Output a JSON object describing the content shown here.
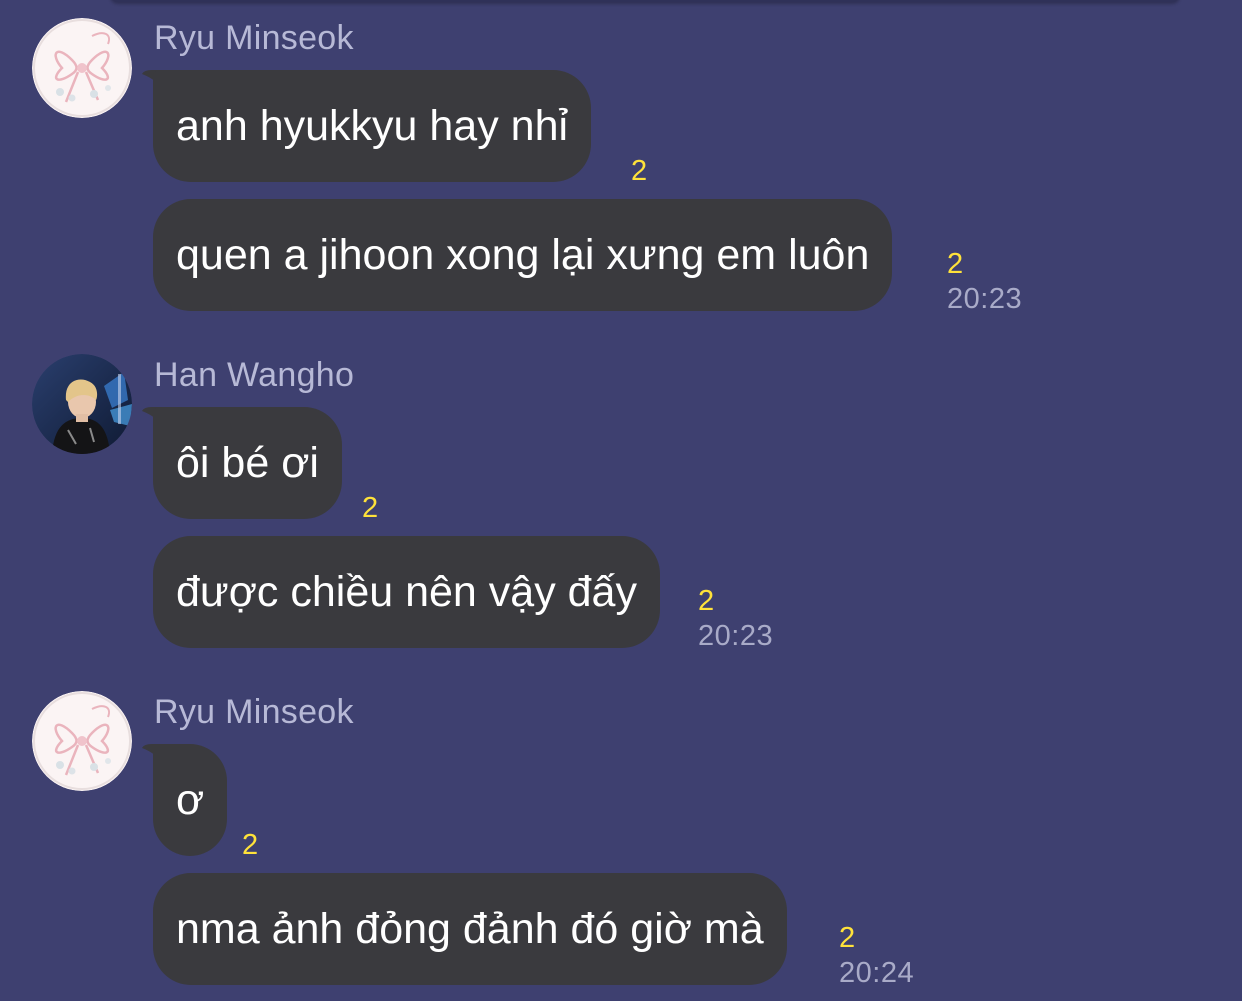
{
  "groups": [
    {
      "sender": "Ryu Minseok",
      "avatar_icon": "ribbon-avatar-icon",
      "messages": [
        {
          "text": "anh hyukkyu hay nhỉ",
          "unread": "2",
          "time": ""
        },
        {
          "text": "quen a jihoon xong lại xưng em luôn",
          "unread": "2",
          "time": "20:23"
        }
      ]
    },
    {
      "sender": "Han Wangho",
      "avatar_icon": "person-photo-avatar-icon",
      "messages": [
        {
          "text": "ôi bé ơi",
          "unread": "2",
          "time": ""
        },
        {
          "text": "được chiều nên vậy đấy",
          "unread": "2",
          "time": "20:23"
        }
      ]
    },
    {
      "sender": "Ryu Minseok",
      "avatar_icon": "ribbon-avatar-icon",
      "messages": [
        {
          "text": "ơ",
          "unread": "2",
          "time": ""
        },
        {
          "text": "nma ảnh đỏng đảnh đó giờ mà",
          "unread": "2",
          "time": "20:24"
        }
      ]
    }
  ],
  "colors": {
    "background": "#3e4070",
    "bubble": "#3a3a3e",
    "sender_name": "#b7b9d6",
    "unread_count": "#ffe23a",
    "timestamp": "#a9abc8"
  }
}
